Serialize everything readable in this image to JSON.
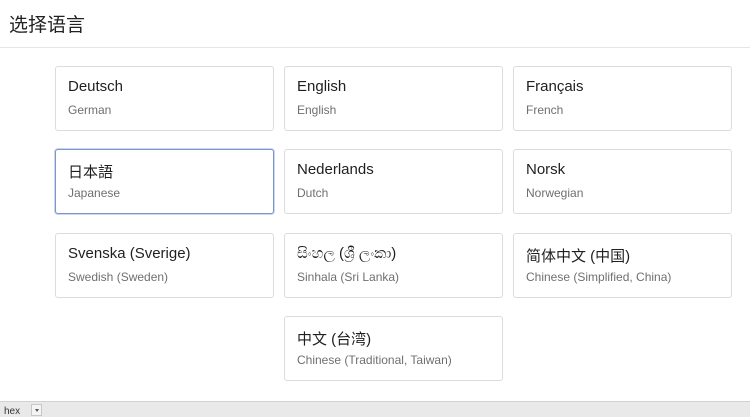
{
  "header": {
    "title": "选择语言"
  },
  "languages": [
    {
      "name": "Deutsch",
      "sub": "German"
    },
    {
      "name": "English",
      "sub": "English"
    },
    {
      "name": "Français",
      "sub": "French"
    },
    {
      "name": "日本語",
      "sub": "Japanese",
      "selected": true
    },
    {
      "name": "Nederlands",
      "sub": "Dutch"
    },
    {
      "name": "Norsk",
      "sub": "Norwegian"
    },
    {
      "name": "Svenska (Sverige)",
      "sub": "Swedish (Sweden)"
    },
    {
      "name": "සිංහල (ශ්‍රී ලංකා)",
      "sub": "Sinhala (Sri Lanka)"
    },
    {
      "name": "简体中文 (中国)",
      "sub": "Chinese (Simplified, China)"
    },
    {
      "name": "中文 (台湾)",
      "sub": "Chinese (Traditional, Taiwan)"
    }
  ],
  "statusbar": {
    "text": "hex"
  }
}
